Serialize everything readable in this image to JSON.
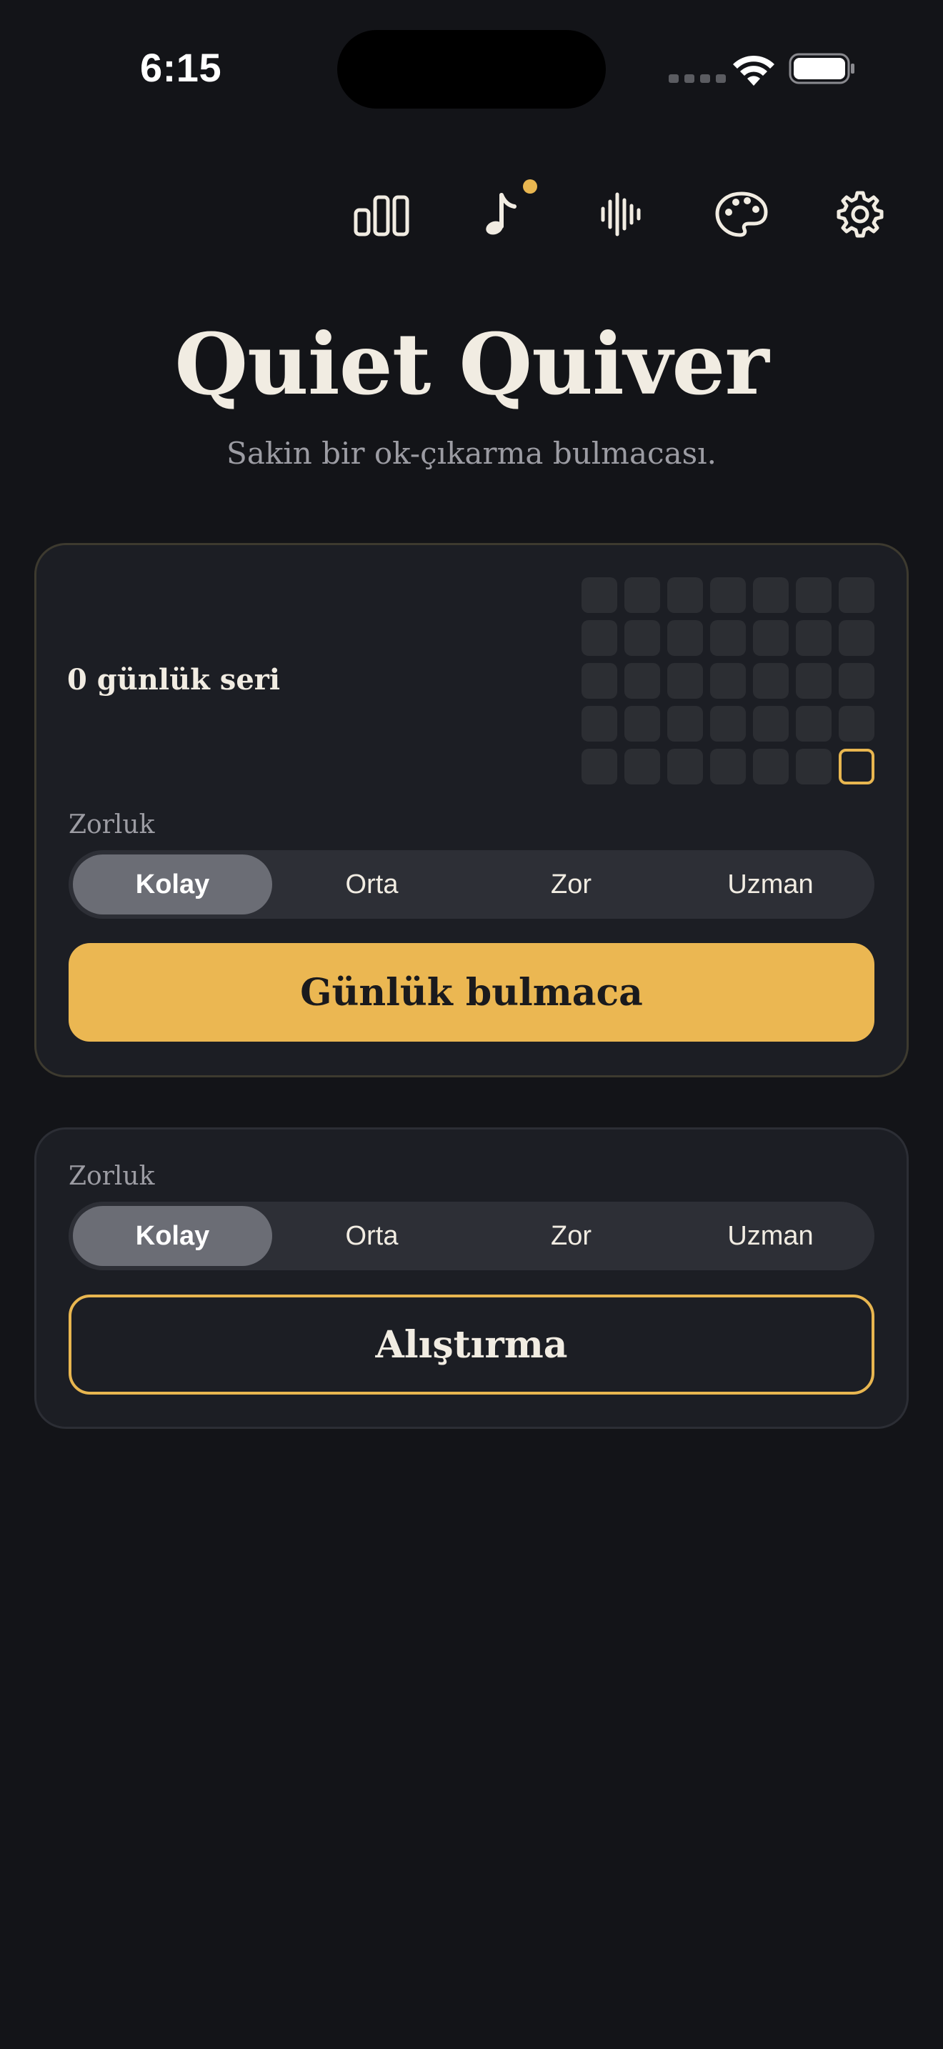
{
  "status_bar": {
    "time": "6:15"
  },
  "toolbar": {
    "icons": [
      "stats-icon",
      "music-icon",
      "sound-wave-icon",
      "palette-icon",
      "settings-icon"
    ],
    "badge_color": "#e8b650"
  },
  "header": {
    "title": "Quiet Quiver",
    "subtitle": "Sakin bir ok-çıkarma bulmacası."
  },
  "daily": {
    "streak_label": "0 günlük seri",
    "streak_grid": {
      "rows": 5,
      "columns": 7,
      "completed_days": 0,
      "today_highlighted": true
    },
    "difficulty_label": "Zorluk",
    "difficulties": [
      "Kolay",
      "Orta",
      "Zor",
      "Uzman"
    ],
    "selected_difficulty": "Kolay",
    "button_label": "Günlük bulmaca"
  },
  "practice": {
    "difficulty_label": "Zorluk",
    "difficulties": [
      "Kolay",
      "Orta",
      "Zor",
      "Uzman"
    ],
    "selected_difficulty": "Kolay",
    "button_label": "Alıştırma"
  },
  "colors": {
    "background": "#131418",
    "card": "#1c1e24",
    "accent": "#ebb752",
    "text_primary": "#f1ece2",
    "text_muted": "#9c9ca3"
  }
}
